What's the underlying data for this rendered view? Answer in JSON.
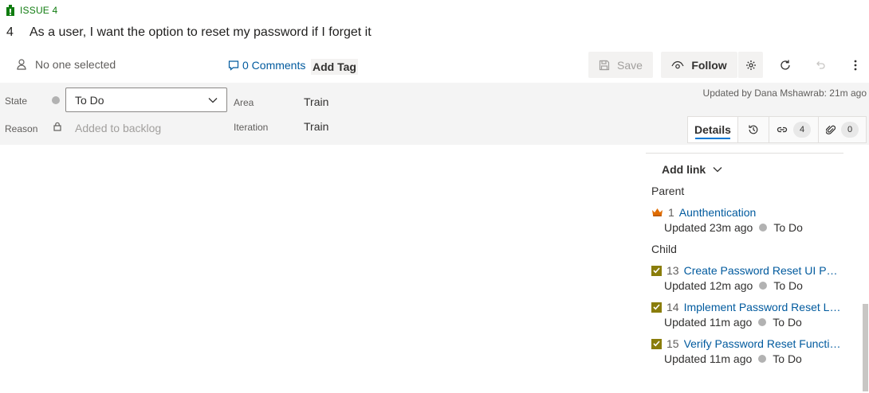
{
  "header": {
    "issue_tag": "ISSUE 4",
    "work_item_id": "4",
    "title": "As a user, I want the option to reset my password if I forget it"
  },
  "toolbar": {
    "assignee": "No one selected",
    "comments": "0 Comments",
    "add_tag": "Add Tag",
    "save": "Save",
    "follow": "Follow"
  },
  "fields": {
    "state_label": "State",
    "state_value": "To Do",
    "reason_label": "Reason",
    "reason_value": "Added to backlog",
    "area_label": "Area",
    "area_value": "Train",
    "iteration_label": "Iteration",
    "iteration_value": "Train"
  },
  "updated_by": "Updated by Dana Mshawrab: 21m ago",
  "tabs": {
    "details": "Details",
    "links_count": "4",
    "attachments_count": "0"
  },
  "links_panel": {
    "add_link": "Add link",
    "parent_header": "Parent",
    "child_header": "Child",
    "parent": {
      "id": "1",
      "title": "Aunthentication",
      "updated": "Updated 23m ago",
      "state": "To Do"
    },
    "children": [
      {
        "id": "13",
        "title": "Create Password Reset UI Page",
        "updated": "Updated 12m ago",
        "state": "To Do"
      },
      {
        "id": "14",
        "title": "Implement Password Reset Lo...",
        "updated": "Updated 11m ago",
        "state": "To Do"
      },
      {
        "id": "15",
        "title": "Verify Password Reset Functio...",
        "updated": "Updated 11m ago",
        "state": "To Do"
      }
    ]
  },
  "colors": {
    "issue_green": "#107c10",
    "link_blue": "#005a9e",
    "accent_blue": "#0078d4",
    "epic_orange": "#e06c00",
    "task_olive": "#8a7d0b",
    "state_gray": "#b2b2b2"
  },
  "icons": [
    "issue-icon",
    "person-icon",
    "comment-icon",
    "save-icon",
    "eye-icon",
    "gear-icon",
    "refresh-icon",
    "undo-icon",
    "more-icon",
    "chevron-down-icon",
    "lock-icon",
    "history-icon",
    "link-icon",
    "attachment-icon",
    "crown-icon",
    "checkbox-icon"
  ]
}
